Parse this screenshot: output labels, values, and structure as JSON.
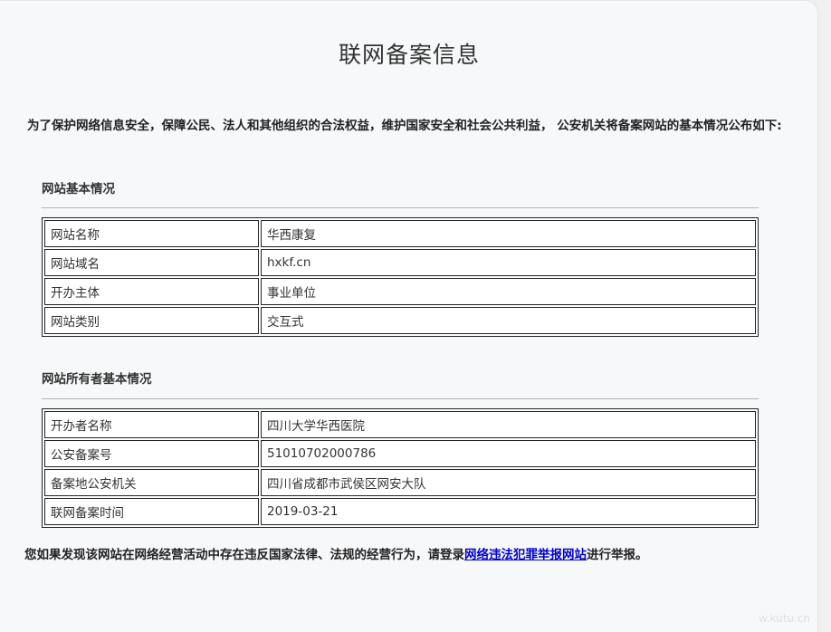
{
  "page": {
    "title": "联网备案信息",
    "intro": "为了保护网络信息安全，保障公民、法人和其他组织的合法权益，维护国家安全和社会公共利益， 公安机关将备案网站的基本情况公布如下:"
  },
  "basic": {
    "heading": "网站基本情况",
    "rows": [
      {
        "label": "网站名称",
        "value": "华西康复"
      },
      {
        "label": "网站域名",
        "value": "hxkf.cn"
      },
      {
        "label": "开办主体",
        "value": "事业单位"
      },
      {
        "label": "网站类别",
        "value": "交互式"
      }
    ]
  },
  "owner": {
    "heading": "网站所有者基本情况",
    "rows": [
      {
        "label": "开办者名称",
        "value": "四川大学华西医院"
      },
      {
        "label": "公安备案号",
        "value": "51010702000786"
      },
      {
        "label": "备案地公安机关",
        "value": "四川省成都市武侯区网安大队"
      },
      {
        "label": "联网备案时间",
        "value": "2019-03-21"
      }
    ]
  },
  "notice": {
    "before": "您如果发现该网站在网络经营活动中存在违反国家法律、法规的经营行为，请登录",
    "link": "网络违法犯罪举报网站",
    "after": "进行举报。"
  },
  "watermark": "w.kutu.cn"
}
